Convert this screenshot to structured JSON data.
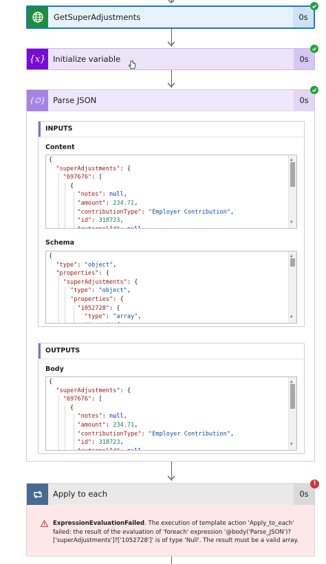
{
  "steps": {
    "get_super": {
      "title": "GetSuperAdjustments",
      "duration": "0s"
    },
    "init_var": {
      "title": "Initialize variable",
      "duration": "0s",
      "icon_text": "{x}"
    },
    "parse_json": {
      "title": "Parse JSON",
      "duration": "0s",
      "icon_text": "{∅}"
    },
    "apply_each": {
      "title": "Apply to each",
      "duration": "0s"
    }
  },
  "inputs": {
    "header": "INPUTS",
    "content_label": "Content",
    "schema_label": "Schema"
  },
  "outputs": {
    "header": "OUTPUTS",
    "body_label": "Body"
  },
  "error": {
    "title": "ExpressionEvaluationFailed",
    "message": ". The execution of template action 'Apply_to_each' failed: the result of the evaluation of 'foreach' expression '@body('Parse_JSON')?['superAdjustments']?['1052728']' is of type 'Null'. The result must be a valid array."
  },
  "code": {
    "content_lines": [
      "{",
      "  \"superAdjustments\": {",
      "    \"697676\": [",
      "      {",
      "        \"notes\": null,",
      "        \"amount\": 234.71,",
      "        \"contributionType\": \"Employer Contribution\",",
      "        \"id\": 318723,",
      "        \"externalId\": null"
    ],
    "schema_lines": [
      "{",
      "  \"type\": \"object\",",
      "  \"properties\": {",
      "    \"superAdjustments\": {",
      "      \"type\": \"object\",",
      "      \"properties\": {",
      "        \"1052728\": {",
      "          \"type\": \"array\",",
      "          \"items\": {"
    ],
    "body_lines": [
      "{",
      "  \"superAdjustments\": {",
      "    \"697676\": [",
      "      {",
      "        \"notes\": null,",
      "        \"amount\": 234.71,",
      "        \"contributionType\": \"Employer Contribution\",",
      "        \"id\": 318723,",
      "        \"externalId\": null"
    ]
  },
  "colors": {
    "http_accent": "#1e8e3e",
    "variable_accent": "#770bd6",
    "parse_accent": "#a582e6",
    "loop_accent": "#486991",
    "success": "#21a33a",
    "error": "#d13438"
  }
}
